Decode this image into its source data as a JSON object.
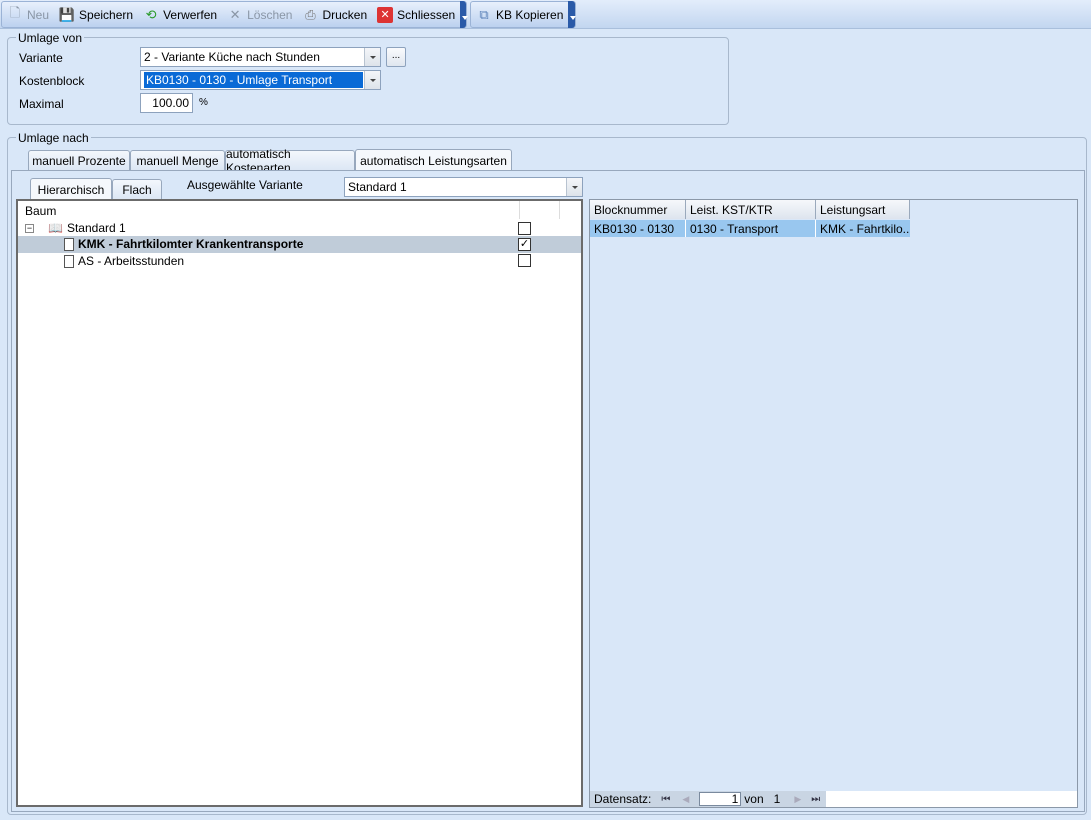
{
  "toolbar": {
    "new": "Neu",
    "save": "Speichern",
    "discard": "Verwerfen",
    "delete": "Löschen",
    "print": "Drucken",
    "close": "Schliessen",
    "copy_kb": "KB Kopieren"
  },
  "umlage_von": {
    "title": "Umlage von",
    "variante_label": "Variante",
    "variante_value": "2 - Variante Küche nach Stunden",
    "ellipsis": "...",
    "kostenblock_label": "Kostenblock",
    "kostenblock_value": "KB0130 - 0130 - Umlage Transport",
    "maximal_label": "Maximal",
    "maximal_value": "100.00",
    "percent": "%"
  },
  "umlage_nach": {
    "title": "Umlage nach",
    "tabs": [
      "manuell Prozente",
      "manuell Menge",
      "automatisch Kostenarten",
      "automatisch Leistungsarten"
    ],
    "subtabs": [
      "Hierarchisch",
      "Flach"
    ],
    "variant_label": "Ausgewählte Variante",
    "variant_value": "Standard 1",
    "tree": {
      "header": "Baum",
      "root": "Standard 1",
      "items": [
        {
          "label": "KMK - Fahrtkilomter Krankentransporte",
          "checked": true
        },
        {
          "label": "AS - Arbeitsstunden",
          "checked": false
        }
      ]
    },
    "grid": {
      "columns": [
        "Blocknummer",
        "Leist. KST/KTR",
        "Leistungsart"
      ],
      "rows": [
        [
          "KB0130 - 0130",
          "0130 - Transport",
          "KMK - Fahrtkilo..."
        ]
      ]
    },
    "nav": {
      "label": "Datensatz:",
      "current": "1",
      "of": "von",
      "total": "1"
    }
  }
}
